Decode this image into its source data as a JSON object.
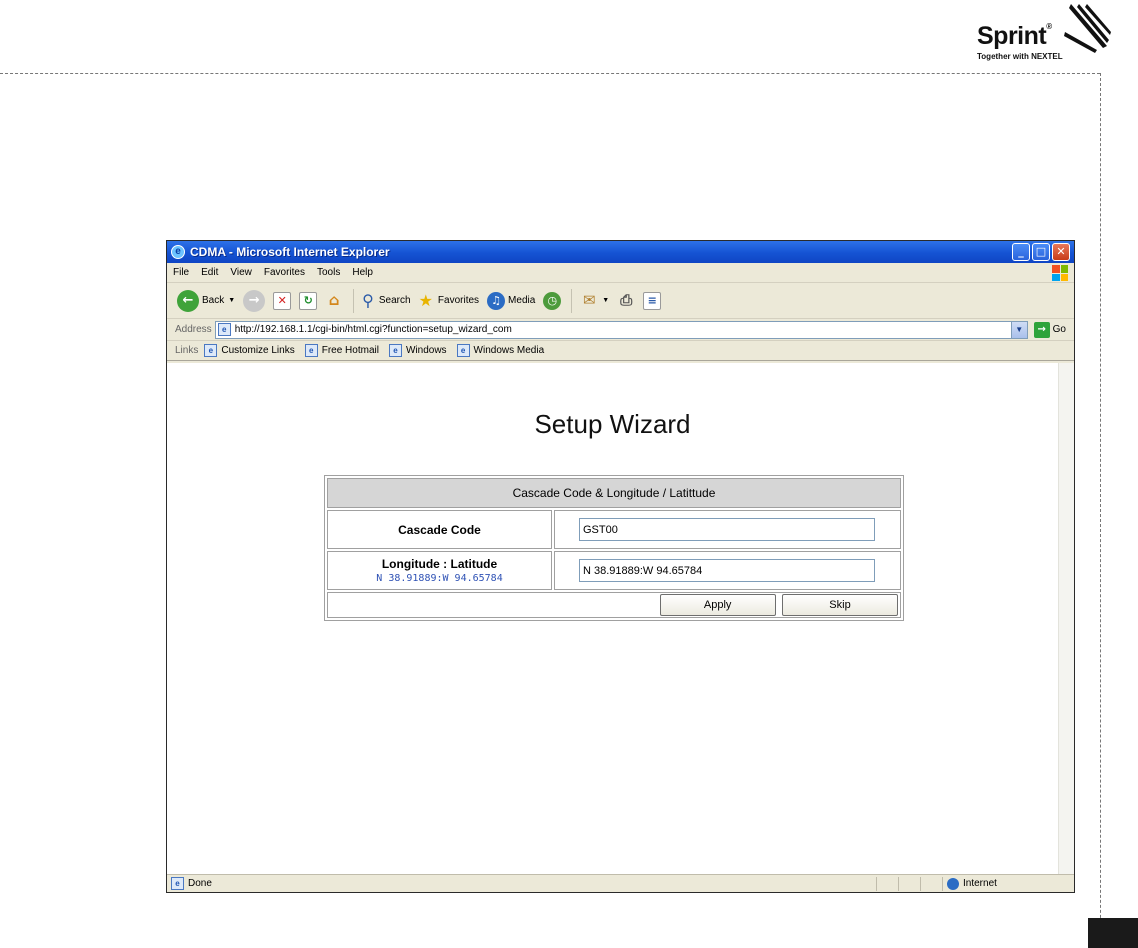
{
  "brand": {
    "name": "Sprint",
    "tagline": "Together with NEXTEL"
  },
  "window": {
    "title": "CDMA - Microsoft Internet Explorer",
    "controls": {
      "minimize": "_",
      "maximize": "□",
      "close": "✕"
    }
  },
  "menu": [
    "File",
    "Edit",
    "View",
    "Favorites",
    "Tools",
    "Help"
  ],
  "toolbar": {
    "back_label": "Back",
    "search_label": "Search",
    "favorites_label": "Favorites",
    "media_label": "Media"
  },
  "address": {
    "label": "Address",
    "url": "http://192.168.1.1/cgi-bin/html.cgi?function=setup_wizard_com",
    "go_label": "Go"
  },
  "links": {
    "label": "Links",
    "items": [
      "Customize Links",
      "Free Hotmail",
      "Windows",
      "Windows Media"
    ]
  },
  "wizard": {
    "title": "Setup Wizard",
    "section_header": "Cascade Code & Longitude / Latittude",
    "rows": [
      {
        "label": "Cascade Code",
        "sublabel": "",
        "value": "GST00"
      },
      {
        "label": "Longitude : Latitude",
        "sublabel": "N 38.91889:W 94.65784",
        "value": "N 38.91889:W 94.65784"
      }
    ],
    "apply_label": "Apply",
    "skip_label": "Skip"
  },
  "status": {
    "text": "Done",
    "zone": "Internet"
  },
  "colors": {
    "titlebar": "#1553d3",
    "chrome": "#ece9d8",
    "header_cell": "#d6d6d6",
    "sublabel": "#2f52b5"
  }
}
